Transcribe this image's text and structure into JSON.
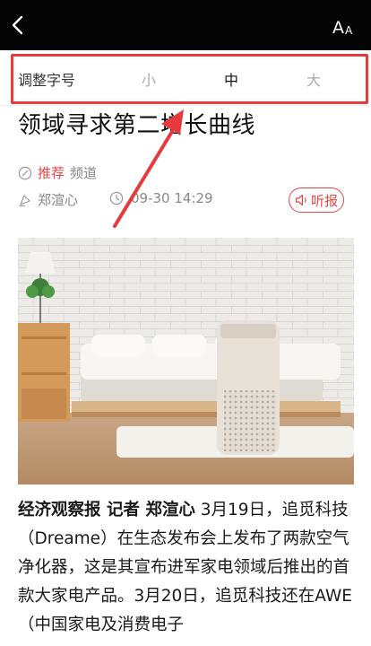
{
  "font_panel": {
    "label": "调整字号",
    "options": [
      "小",
      "中",
      "大"
    ],
    "selected": "中"
  },
  "article": {
    "title": "领域寻求第二增长曲线",
    "channel_tag": "推荐",
    "channel_label": "频道",
    "author": "郑渲心",
    "time": "09-30 14:29",
    "listen_label": "听报",
    "body_source": "经济观察报 记者 郑渲心",
    "body_text": " 3月19日，追觅科技（Dreame）在生态发布会上发布了两款空气净化器，这是其宣布进军家电领域后推出的首款大家电产品。3月20日，追觅科技还在AWE（中国家电及消费电子"
  },
  "colors": {
    "accent": "#e64545",
    "highlight": "#e63a3e",
    "topbar": "#050505"
  },
  "icons": {
    "back": "chevron-left-icon",
    "font_size": "font-size-icon"
  }
}
